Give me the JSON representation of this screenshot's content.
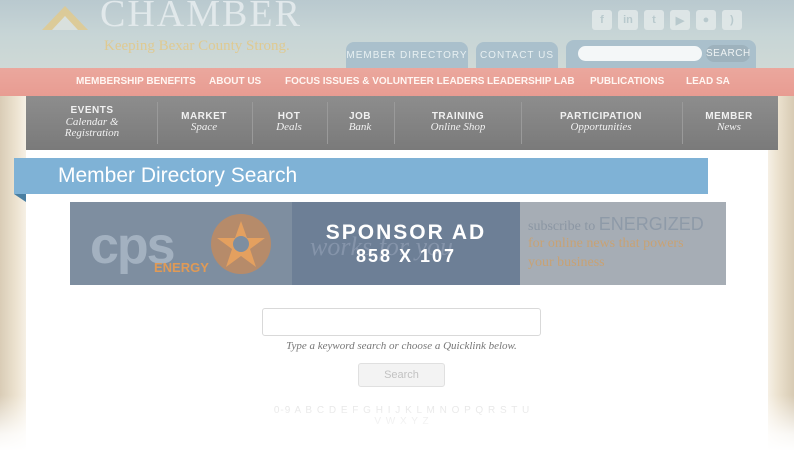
{
  "header": {
    "logo_text": "CHAMBER",
    "tagline": "Keeping Bexar County Strong.",
    "social_icons": [
      "facebook-icon",
      "linkedin-icon",
      "twitter-icon",
      "youtube-icon",
      "flickr-icon",
      "rss-icon"
    ],
    "tabs": [
      {
        "label": "MEMBER DIRECTORY"
      },
      {
        "label": "CONTACT US"
      }
    ],
    "search": {
      "placeholder": "",
      "button_label": "SEARCH"
    }
  },
  "red_nav": {
    "items": [
      {
        "label": "MEMBERSHIP BENEFITS"
      },
      {
        "label": "ABOUT US"
      },
      {
        "label": "FOCUS ISSUES & VOLUNTEER LEADERS"
      },
      {
        "label": "LEADERSHIP LAB"
      },
      {
        "label": "PUBLICATIONS"
      },
      {
        "label": "LEAD SA"
      }
    ]
  },
  "gray_nav": {
    "items": [
      {
        "bold": "EVENTS",
        "italic": "Calendar & Registration"
      },
      {
        "bold": "MARKET",
        "italic": "Space"
      },
      {
        "bold": "HOT",
        "italic": "Deals"
      },
      {
        "bold": "JOB",
        "italic": "Bank"
      },
      {
        "bold": "TRAINING",
        "italic": "Online Shop"
      },
      {
        "bold": "PARTICIPATION",
        "italic": "Opportunities"
      },
      {
        "bold": "MEMBER",
        "italic": "News"
      }
    ]
  },
  "page": {
    "title": "Member Directory Search"
  },
  "ad": {
    "overlay_line1": "SPONSOR AD",
    "overlay_line2": "858 X 107",
    "brand": "cps",
    "brand_sub": "ENERGY",
    "middle_text": "works for you",
    "right_line1_a": "subscribe to ",
    "right_line1_b": "ENERGIZED",
    "right_line2": "for online news that powers",
    "right_line3": "your business"
  },
  "search": {
    "keyword_value": "",
    "keyword_placeholder": "",
    "hint": "Type a keyword search or choose a Quicklink below.",
    "button_label": "Search",
    "alphabet": "0-9 A B C D E F G H I J K L M N O P Q R S T U V W X Y Z"
  },
  "colors": {
    "header_bg": "#c7d5d6",
    "red_nav": "#e89c92",
    "gray_nav": "#838383",
    "banner": "#7fb2d6",
    "ad_overlay": "#6d7f96"
  }
}
